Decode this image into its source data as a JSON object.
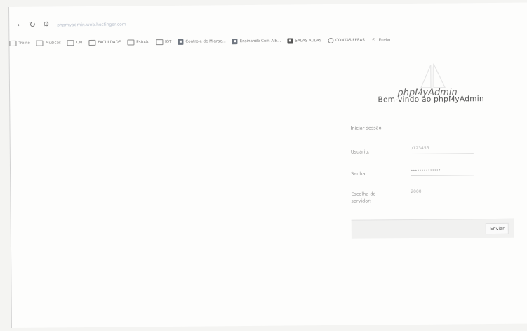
{
  "browser": {
    "url": "phpmyadmin.web.hostinger.com",
    "bookmarks": [
      {
        "label": "Treino",
        "icon": "folder-icon"
      },
      {
        "label": "Músicas",
        "icon": "folder-icon"
      },
      {
        "label": "CM",
        "icon": "folder-icon"
      },
      {
        "label": "FACULDADE",
        "icon": "folder-icon"
      },
      {
        "label": "Estudo",
        "icon": "folder-icon"
      },
      {
        "label": "IOT",
        "icon": "folder-icon"
      },
      {
        "label": "Controle de Migrac...",
        "icon": "bookmark-favicon"
      },
      {
        "label": "Ensinando Com Alb...",
        "icon": "bookmark-favicon"
      },
      {
        "label": "SALAS AULAS",
        "icon": "bookmark-favicon"
      },
      {
        "label": "CONTAS FEEAS",
        "icon": "bookmark-favicon"
      },
      {
        "label": "Enviar",
        "icon": "bookmark-favicon"
      }
    ]
  },
  "login": {
    "logo_text": "phpMyAdmin",
    "welcome": "Bem-vindo ao phpMyAdmin",
    "section_title": "Iniciar sessão",
    "username_label": "Usuário:",
    "username_value": "u123456",
    "password_label": "Senha:",
    "password_value": "••••••••••••••",
    "server_choice_label_line1": "Escolha do",
    "server_choice_label_line2": "servidor:",
    "server_value": "2000",
    "submit_label": "Enviar"
  },
  "colors": {
    "page_bg": "#fdfdfc",
    "text": "#555555",
    "muted_text": "#9a9a9a",
    "footer_bar": "#f1f1f0"
  }
}
